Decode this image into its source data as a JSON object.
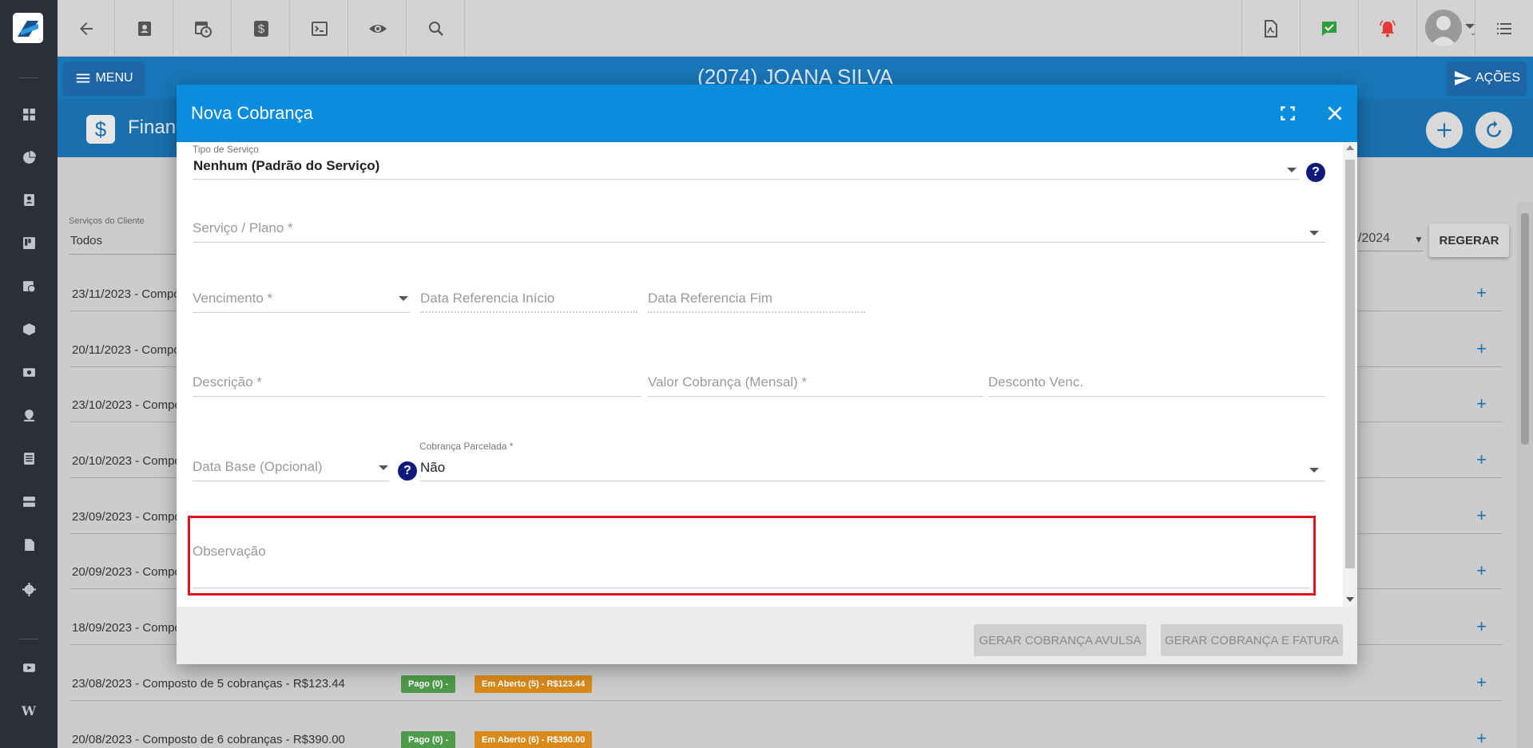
{
  "topbar": {
    "icons": [
      "back-arrow-icon",
      "contact-card-icon",
      "calendar-clock-icon",
      "dollar-icon",
      "terminal-icon",
      "eye-icon",
      "search-icon",
      "pdf-icon",
      "chat-check-icon",
      "alarm-bell-icon",
      "user-avatar",
      "list-menu-icon"
    ],
    "accent_colors": {
      "chat_check": "#2e9e3e",
      "alarm_bell": "#e53935"
    }
  },
  "bluebar": {
    "menu_label": "MENU",
    "client_name": "(2074) JOANA SILVA",
    "acoes_label": "AÇÕES"
  },
  "section": {
    "title": "Financ",
    "icon": "dollar-icon"
  },
  "content": {
    "services_label": "Serviços do Cliente",
    "services_value": "Todos",
    "date_value": "/2024",
    "regerar_label": "REGERAR",
    "rows": [
      {
        "text": "23/11/2023 - Compo"
      },
      {
        "text": "20/11/2023 - Compo"
      },
      {
        "text": "23/10/2023 - Compo"
      },
      {
        "text": "20/10/2023 - Compo"
      },
      {
        "text": "23/09/2023 - Compo"
      },
      {
        "text": "20/09/2023 - Compo"
      },
      {
        "text": "18/09/2023 - Compo"
      },
      {
        "text": "23/08/2023 - Composto de 5 cobranças - R$123.44",
        "badge_paid": "Pago (0) -",
        "badge_open": "Em Aberto (5) - R$123.44"
      },
      {
        "text": "20/08/2023 - Composto de 6 cobranças - R$390.00",
        "badge_paid": "Pago (0) -",
        "badge_open": "Em Aberto (6) - R$390.00"
      }
    ]
  },
  "modal": {
    "title": "Nova Cobrança",
    "fields": {
      "tipo_servico_label": "Tipo de Serviço",
      "tipo_servico_value": "Nenhum (Padrão do Serviço)",
      "servico_plano": "Serviço / Plano *",
      "vencimento": "Vencimento *",
      "data_ref_inicio": "Data Referencia Início",
      "data_ref_fim": "Data Referencia Fim",
      "descricao": "Descrição *",
      "valor_cobranca": "Valor Cobrança (Mensal) *",
      "desconto_venc": "Desconto Venc.",
      "data_base": "Data Base (Opcional)",
      "cobranca_parcelada_label": "Cobrança Parcelada *",
      "cobranca_parcelada_value": "Não",
      "observacao": "Observação"
    },
    "help_glyph": "?",
    "buttons": {
      "avulsa": "GERAR COBRANÇA AVULSA",
      "fatura": "GERAR COBRANÇA E FATURA"
    },
    "highlight_color": "#e0141a"
  }
}
